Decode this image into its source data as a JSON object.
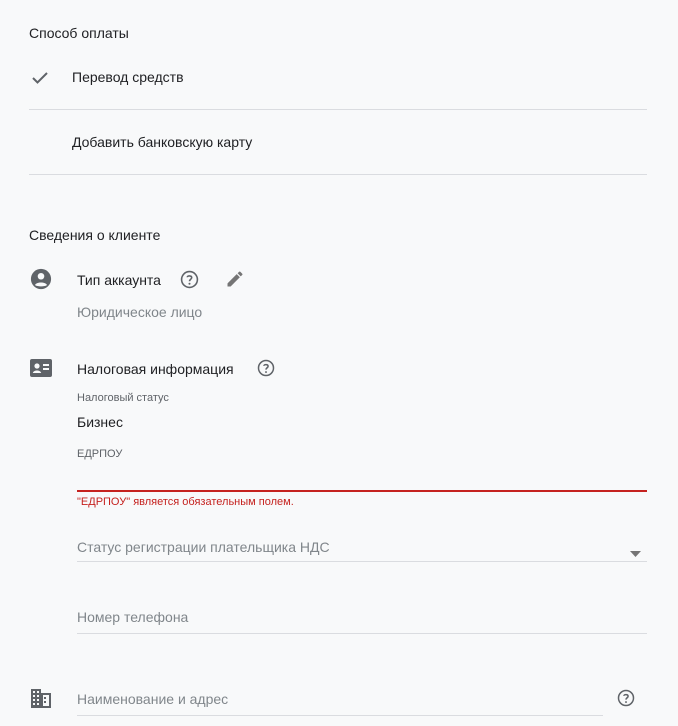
{
  "payment": {
    "title": "Способ оплаты",
    "options": [
      {
        "label": "Перевод средств",
        "selected": true
      },
      {
        "label": "Добавить банковскую карту",
        "selected": false
      }
    ]
  },
  "client": {
    "title": "Сведения о клиенте",
    "account_type": {
      "label": "Тип аккаунта",
      "value": "Юридическое лицо"
    },
    "tax": {
      "label": "Налоговая информация",
      "status_label": "Налоговый статус",
      "status_value": "Бизнес",
      "edrpou_label": "ЕДРПОУ",
      "edrpou_value": "",
      "edrpou_error": "\"ЕДРПОУ\" является обязательным полем.",
      "vat_placeholder": "Статус регистрации плательщика НДС",
      "phone_placeholder": "Номер телефона"
    },
    "name_address_placeholder": "Наименование и адрес"
  },
  "icons": {
    "check": "check-icon",
    "account": "account-circle-icon",
    "help": "help-circle-icon",
    "edit": "pencil-icon",
    "tax": "id-card-icon",
    "dropdown": "caret-down-icon",
    "building": "building-icon"
  },
  "colors": {
    "background": "#f8f9fa",
    "error": "#c5221f",
    "icon": "#5f6368",
    "divider": "#dadce0"
  }
}
